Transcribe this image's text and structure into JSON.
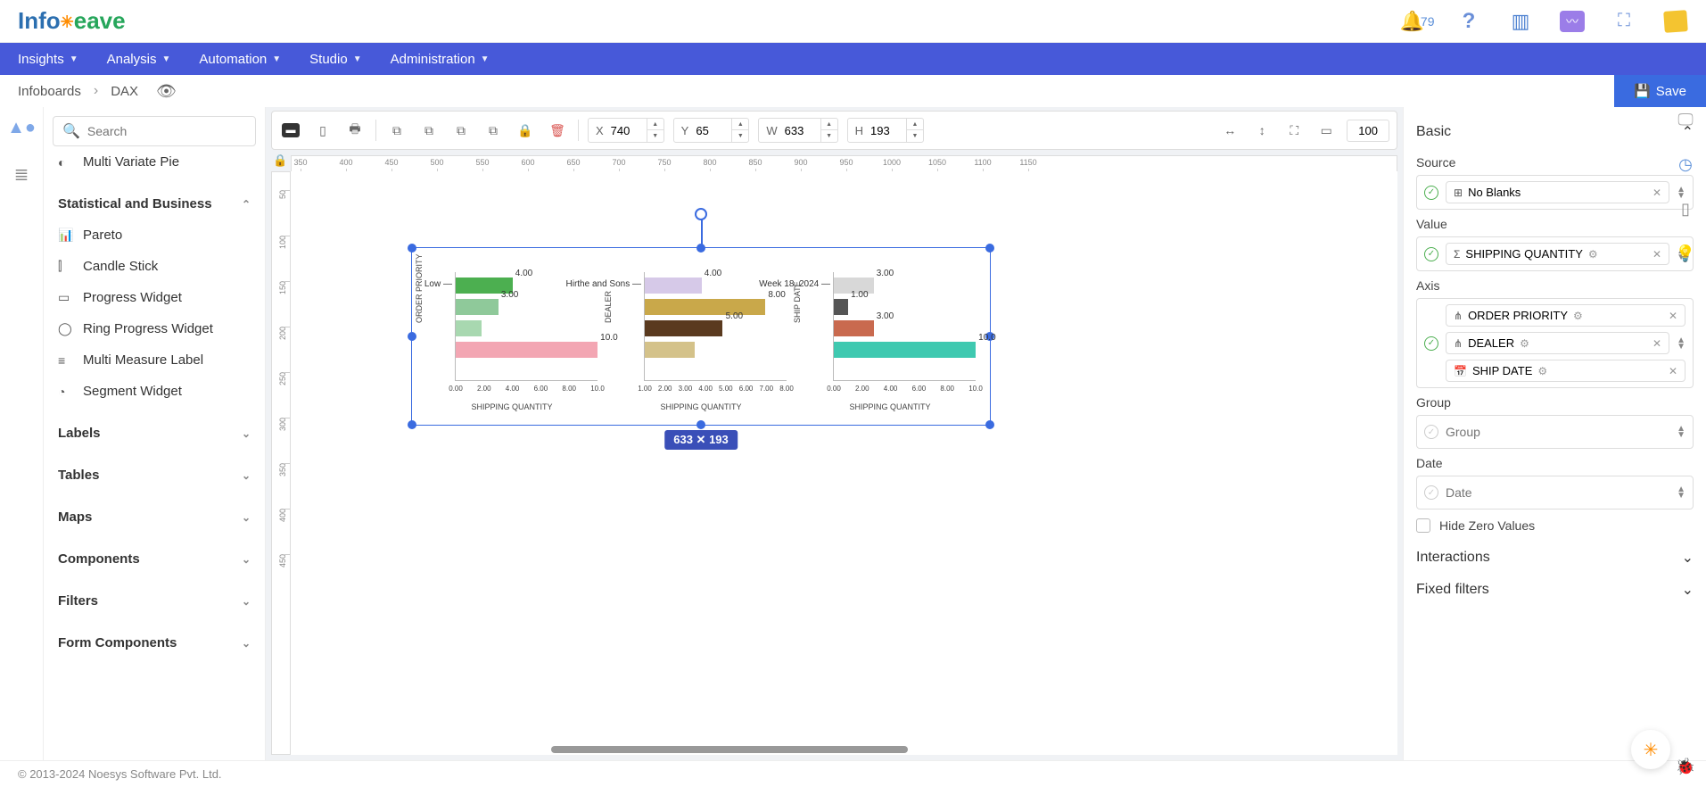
{
  "header": {
    "logo": {
      "part1": "Info",
      "part2": "eave"
    },
    "notification_count": "79"
  },
  "nav": {
    "items": [
      "Insights",
      "Analysis",
      "Automation",
      "Studio",
      "Administration"
    ]
  },
  "breadcrumb": {
    "root": "Infoboards",
    "current": "DAX",
    "save": "Save"
  },
  "toolbar": {
    "x": "740",
    "y": "65",
    "w": "633",
    "h": "193",
    "zoom": "100"
  },
  "ruler_h": [
    "350",
    "400",
    "450",
    "500",
    "550",
    "600",
    "650",
    "700",
    "750",
    "800",
    "850",
    "900",
    "950",
    "1000",
    "1050",
    "1100",
    "1150"
  ],
  "ruler_v": [
    "50",
    "100",
    "150",
    "200",
    "250",
    "300",
    "350",
    "400",
    "450"
  ],
  "left": {
    "search_placeholder": "Search",
    "item_mvp": "Multi Variate Pie",
    "cat_stat": "Statistical and Business",
    "pareto": "Pareto",
    "candle": "Candle Stick",
    "progress": "Progress Widget",
    "ring": "Ring Progress Widget",
    "mml": "Multi Measure Label",
    "segment": "Segment Widget",
    "labels": "Labels",
    "tables": "Tables",
    "maps": "Maps",
    "components": "Components",
    "filters": "Filters",
    "form": "Form Components"
  },
  "widget": {
    "size_w": "633",
    "size_h": "193"
  },
  "chart_data": [
    {
      "type": "bar",
      "orientation": "horizontal",
      "ylabel": "ORDER PRIORITY",
      "xlabel": "SHIPPING QUANTITY",
      "category_label": "Low",
      "xticks": [
        "0.00",
        "2.00",
        "4.00",
        "6.00",
        "8.00",
        "10.0"
      ],
      "bars": [
        {
          "value": "4.00",
          "width_pct": 40,
          "color": "#4caf50"
        },
        {
          "value": "3.00",
          "width_pct": 30,
          "color": "#8fc99a"
        },
        {
          "value": "",
          "width_pct": 18,
          "color": "#a8d8b0"
        },
        {
          "value": "10.0",
          "width_pct": 100,
          "color": "#f3a6b3"
        }
      ]
    },
    {
      "type": "bar",
      "orientation": "horizontal",
      "ylabel": "DEALER",
      "xlabel": "SHIPPING QUANTITY",
      "category_label": "Hirthe and Sons",
      "xticks": [
        "1.00",
        "2.00",
        "3.00",
        "4.00",
        "5.00",
        "6.00",
        "7.00",
        "8.00"
      ],
      "bars": [
        {
          "value": "4.00",
          "width_pct": 40,
          "color": "#d6c9e8"
        },
        {
          "value": "8.00",
          "width_pct": 85,
          "color": "#c9a84a"
        },
        {
          "value": "5.00",
          "width_pct": 55,
          "color": "#5a3a1f"
        },
        {
          "value": "",
          "width_pct": 35,
          "color": "#d4c28a"
        }
      ]
    },
    {
      "type": "bar",
      "orientation": "horizontal",
      "ylabel": "SHIP DATE",
      "xlabel": "SHIPPING QUANTITY",
      "category_label": "Week 18, 2024",
      "xticks": [
        "0.00",
        "2.00",
        "4.00",
        "6.00",
        "8.00",
        "10.0"
      ],
      "bars": [
        {
          "value": "3.00",
          "width_pct": 28,
          "color": "#d8d8d8"
        },
        {
          "value": "1.00",
          "width_pct": 10,
          "color": "#555"
        },
        {
          "value": "3.00",
          "width_pct": 28,
          "color": "#c96a4f"
        },
        {
          "value": "10.0",
          "width_pct": 100,
          "color": "#3fc9b0"
        }
      ]
    }
  ],
  "right": {
    "basic": "Basic",
    "source": "Source",
    "source_val": "No Blanks",
    "value": "Value",
    "value_val": "SHIPPING QUANTITY",
    "axis": "Axis",
    "axis1": "ORDER PRIORITY",
    "axis2": "DEALER",
    "axis3": "SHIP DATE",
    "group": "Group",
    "group_placeholder": "Group",
    "date": "Date",
    "date_placeholder": "Date",
    "hidezero": "Hide Zero Values",
    "interactions": "Interactions",
    "fixedfilters": "Fixed filters"
  },
  "footer": {
    "copyright": "© 2013-2024 Noesys Software Pvt. Ltd."
  }
}
